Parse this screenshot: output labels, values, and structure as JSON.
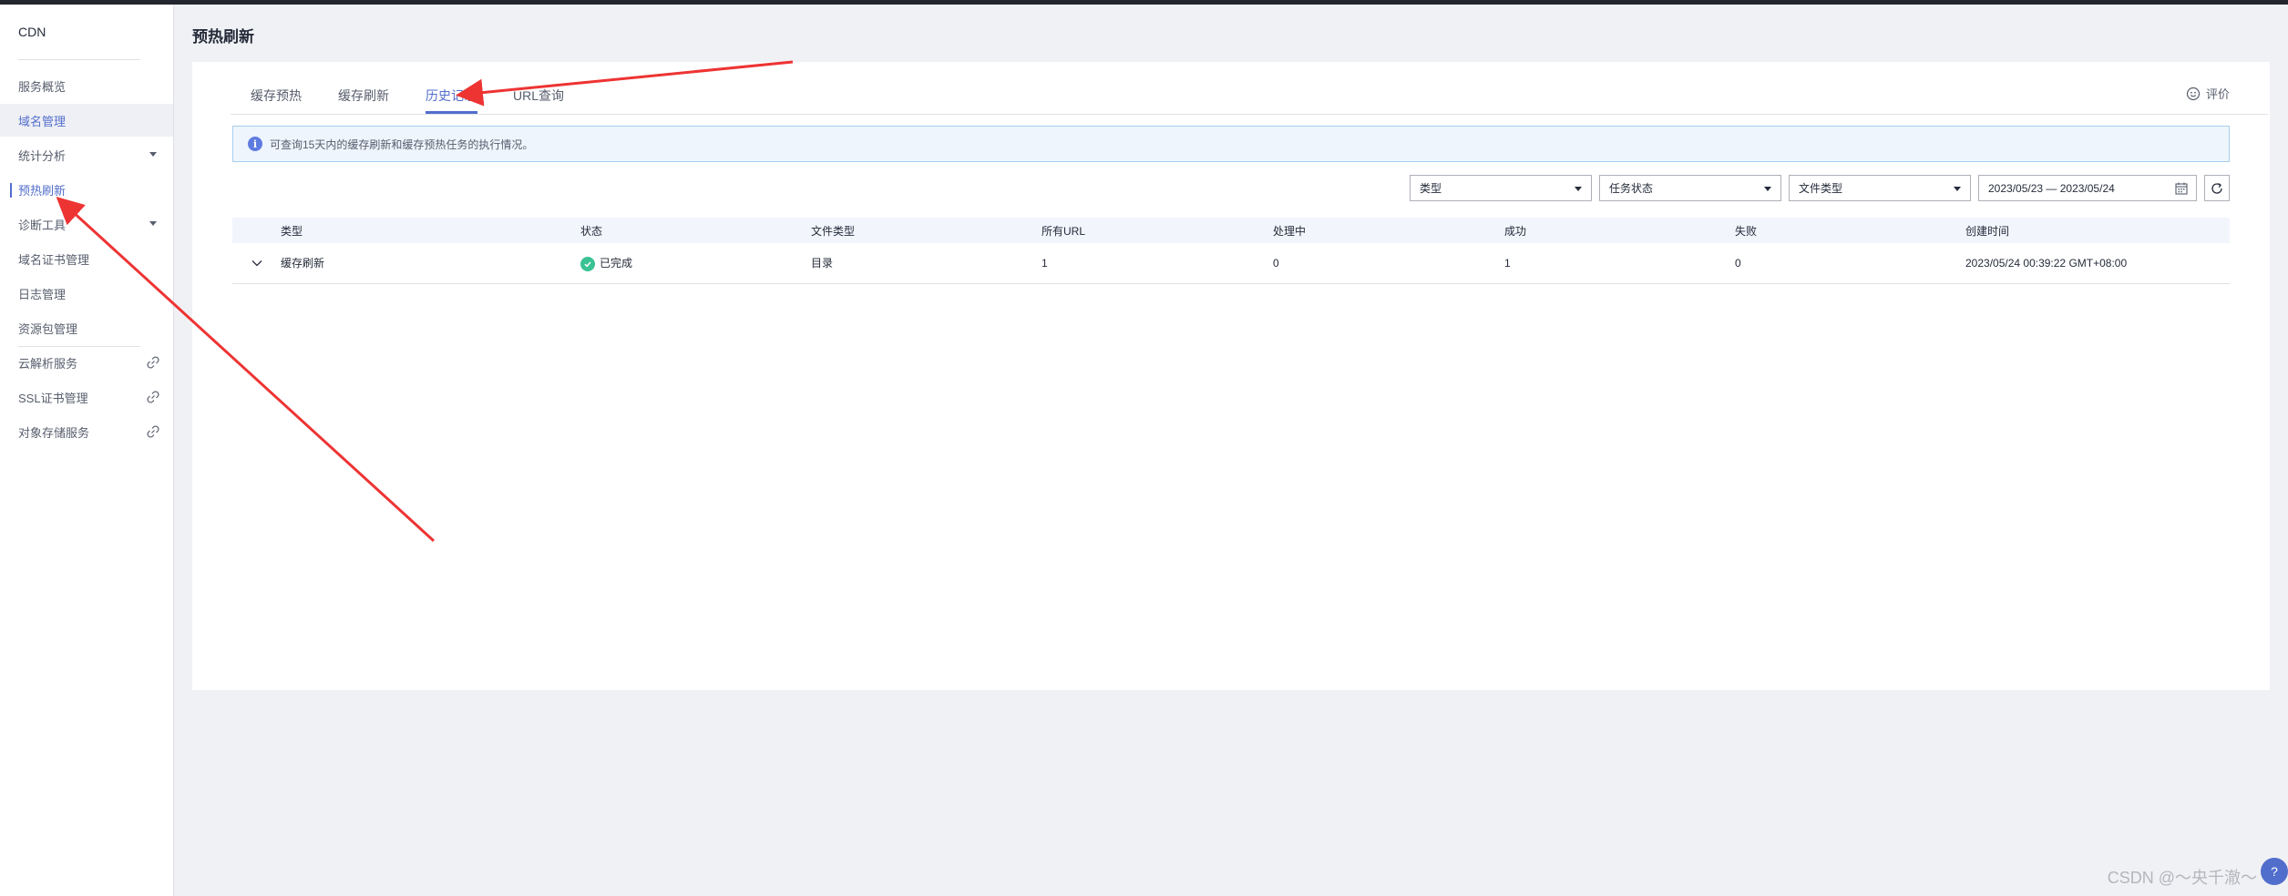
{
  "sidebar": {
    "title": "CDN",
    "items": [
      {
        "label": "服务概览"
      },
      {
        "label": "域名管理"
      },
      {
        "label": "统计分析"
      },
      {
        "label": "预热刷新"
      },
      {
        "label": "诊断工具"
      },
      {
        "label": "域名证书管理"
      },
      {
        "label": "日志管理"
      },
      {
        "label": "资源包管理"
      },
      {
        "label": "云解析服务"
      },
      {
        "label": "SSL证书管理"
      },
      {
        "label": "对象存储服务"
      }
    ]
  },
  "page": {
    "title": "预热刷新"
  },
  "tabs": [
    {
      "label": "缓存预热"
    },
    {
      "label": "缓存刷新"
    },
    {
      "label": "历史记录"
    },
    {
      "label": "URL查询"
    }
  ],
  "active_tab": "历史记录",
  "rate_label": "评价",
  "info_text": "可查询15天内的缓存刷新和缓存预热任务的执行情况。",
  "filters": {
    "type": "类型",
    "task_status": "任务状态",
    "file_type": "文件类型",
    "date_range": "2023/05/23 — 2023/05/24"
  },
  "table": {
    "headers": [
      "类型",
      "状态",
      "文件类型",
      "所有URL",
      "处理中",
      "成功",
      "失败",
      "创建时间"
    ],
    "rows": [
      {
        "type": "缓存刷新",
        "status": "已完成",
        "file_type": "目录",
        "all_url": "1",
        "processing": "0",
        "success": "1",
        "failed": "0",
        "created": "2023/05/24 00:39:22 GMT+08:00"
      }
    ]
  },
  "watermark": "CSDN @～央千澈～",
  "colors": {
    "accent": "#526ecc",
    "success": "#3ac295",
    "annotation_arrow": "#ee3333"
  },
  "icons": [
    "info-icon",
    "check-circle-icon",
    "chevron-down-icon",
    "calendar-icon",
    "refresh-icon",
    "smile-icon",
    "link-icon",
    "caret-down-icon"
  ]
}
